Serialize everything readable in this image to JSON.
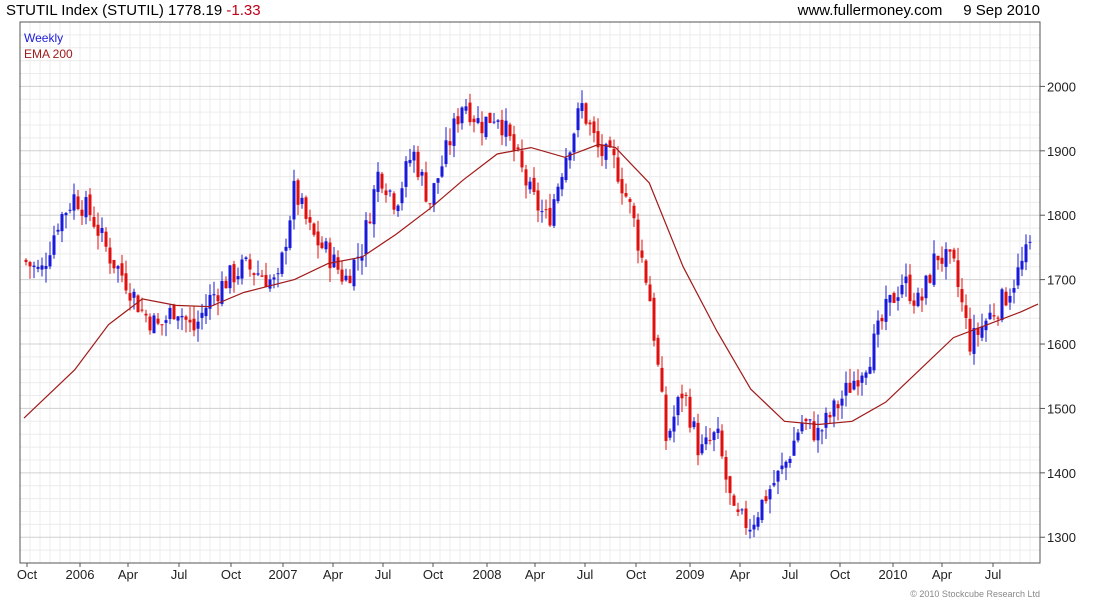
{
  "header": {
    "index_name": "STUTIL Index (STUTIL)",
    "last": "1778.19",
    "change": "-1.33",
    "site": "www.fullermoney.com",
    "date": "9 Sep 2010"
  },
  "legend": {
    "weekly": "Weekly",
    "ema": "EMA 200"
  },
  "copyright": "© 2010 Stockcube Research Ltd",
  "colors": {
    "up": "#1a1adb",
    "down": "#e01010",
    "ema": "#a11a1a",
    "grid": "#d8d8d8"
  },
  "chart_data": {
    "type": "candlestick",
    "interval": "weekly",
    "ylim": [
      1260,
      2100
    ],
    "yticks": [
      1300,
      1400,
      1500,
      1600,
      1700,
      1800,
      1900,
      2000
    ],
    "xticks": [
      "Oct",
      "2006",
      "Apr",
      "Jul",
      "Oct",
      "2007",
      "Apr",
      "Jul",
      "Oct",
      "2008",
      "Apr",
      "Jul",
      "Oct",
      "2009",
      "Apr",
      "Jul",
      "Oct",
      "2010",
      "Apr",
      "Jul"
    ],
    "close_points": [
      {
        "t": "Sep 2005",
        "v": 1730
      },
      {
        "t": "Oct 2005",
        "v": 1710
      },
      {
        "t": "Nov 2005",
        "v": 1790
      },
      {
        "t": "Dec 2005",
        "v": 1830
      },
      {
        "t": "Jan 2006",
        "v": 1800
      },
      {
        "t": "Feb 2006",
        "v": 1740
      },
      {
        "t": "Mar 2006",
        "v": 1700
      },
      {
        "t": "Apr 2006",
        "v": 1650
      },
      {
        "t": "May 2006",
        "v": 1625
      },
      {
        "t": "Jun 2006",
        "v": 1660
      },
      {
        "t": "Jul 2006",
        "v": 1620
      },
      {
        "t": "Aug 2006",
        "v": 1670
      },
      {
        "t": "Sep 2006",
        "v": 1700
      },
      {
        "t": "Oct 2006",
        "v": 1720
      },
      {
        "t": "Nov 2006",
        "v": 1710
      },
      {
        "t": "Dec 2006",
        "v": 1690
      },
      {
        "t": "Jan 2007",
        "v": 1840
      },
      {
        "t": "Feb 2007",
        "v": 1770
      },
      {
        "t": "Mar 2007",
        "v": 1740
      },
      {
        "t": "Apr 2007",
        "v": 1700
      },
      {
        "t": "May 2007",
        "v": 1750
      },
      {
        "t": "Jun 2007",
        "v": 1870
      },
      {
        "t": "Jul 2007",
        "v": 1820
      },
      {
        "t": "Aug 2007",
        "v": 1900
      },
      {
        "t": "Sep 2007",
        "v": 1820
      },
      {
        "t": "Oct 2007",
        "v": 1900
      },
      {
        "t": "Nov 2007",
        "v": 1980
      },
      {
        "t": "Dec 2007",
        "v": 1940
      },
      {
        "t": "Jan 2008",
        "v": 1960
      },
      {
        "t": "Feb 2008",
        "v": 1900
      },
      {
        "t": "Mar 2008",
        "v": 1830
      },
      {
        "t": "Apr 2008",
        "v": 1790
      },
      {
        "t": "May 2008",
        "v": 1890
      },
      {
        "t": "Jun 2008",
        "v": 1970
      },
      {
        "t": "Jul 2008",
        "v": 1900
      },
      {
        "t": "Aug 2008",
        "v": 1880
      },
      {
        "t": "Sep 2008",
        "v": 1800
      },
      {
        "t": "Oct 2008",
        "v": 1680
      },
      {
        "t": "Nov 2008",
        "v": 1450
      },
      {
        "t": "Dec 2008",
        "v": 1530
      },
      {
        "t": "Jan 2009",
        "v": 1430
      },
      {
        "t": "Feb 2009",
        "v": 1460
      },
      {
        "t": "Mar 2009",
        "v": 1330
      },
      {
        "t": "Apr 2009",
        "v": 1320
      },
      {
        "t": "May 2009",
        "v": 1370
      },
      {
        "t": "Jun 2009",
        "v": 1410
      },
      {
        "t": "Jul 2009",
        "v": 1480
      },
      {
        "t": "Aug 2009",
        "v": 1460
      },
      {
        "t": "Sep 2009",
        "v": 1500
      },
      {
        "t": "Oct 2009",
        "v": 1540
      },
      {
        "t": "Nov 2009",
        "v": 1580
      },
      {
        "t": "Dec 2009",
        "v": 1650
      },
      {
        "t": "Jan 2010",
        "v": 1700
      },
      {
        "t": "Feb 2010",
        "v": 1660
      },
      {
        "t": "Mar 2010",
        "v": 1740
      },
      {
        "t": "Apr 2010",
        "v": 1720
      },
      {
        "t": "May 2010",
        "v": 1600
      },
      {
        "t": "Jun 2010",
        "v": 1640
      },
      {
        "t": "Jul 2010",
        "v": 1670
      },
      {
        "t": "Aug 2010",
        "v": 1720
      },
      {
        "t": "Sep 2010",
        "v": 1778.19
      }
    ],
    "ema_points": [
      {
        "t": "Sep 2005",
        "v": 1485
      },
      {
        "t": "Dec 2005",
        "v": 1560
      },
      {
        "t": "Feb 2006",
        "v": 1630
      },
      {
        "t": "Apr 2006",
        "v": 1670
      },
      {
        "t": "Jun 2006",
        "v": 1660
      },
      {
        "t": "Aug 2006",
        "v": 1658
      },
      {
        "t": "Oct 2006",
        "v": 1680
      },
      {
        "t": "Jan 2007",
        "v": 1700
      },
      {
        "t": "Mar 2007",
        "v": 1725
      },
      {
        "t": "May 2007",
        "v": 1735
      },
      {
        "t": "Jul 2007",
        "v": 1770
      },
      {
        "t": "Sep 2007",
        "v": 1810
      },
      {
        "t": "Nov 2007",
        "v": 1855
      },
      {
        "t": "Jan 2008",
        "v": 1895
      },
      {
        "t": "Mar 2008",
        "v": 1905
      },
      {
        "t": "May 2008",
        "v": 1890
      },
      {
        "t": "Jul 2008",
        "v": 1910
      },
      {
        "t": "Aug 2008",
        "v": 1905
      },
      {
        "t": "Oct 2008",
        "v": 1850
      },
      {
        "t": "Dec 2008",
        "v": 1720
      },
      {
        "t": "Feb 2009",
        "v": 1620
      },
      {
        "t": "Apr 2009",
        "v": 1530
      },
      {
        "t": "Jun 2009",
        "v": 1480
      },
      {
        "t": "Aug 2009",
        "v": 1475
      },
      {
        "t": "Oct 2009",
        "v": 1480
      },
      {
        "t": "Dec 2009",
        "v": 1510
      },
      {
        "t": "Feb 2010",
        "v": 1560
      },
      {
        "t": "Apr 2010",
        "v": 1610
      },
      {
        "t": "Jun 2010",
        "v": 1630
      },
      {
        "t": "Aug 2010",
        "v": 1650
      },
      {
        "t": "Sep 2010",
        "v": 1662
      }
    ]
  }
}
